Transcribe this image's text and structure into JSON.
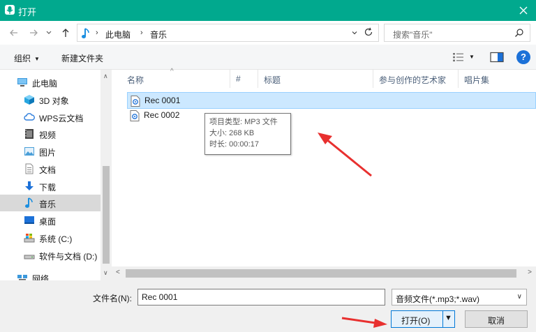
{
  "window": {
    "title": "打开",
    "accent_color": "#01a98e"
  },
  "addressbar": {
    "back_icon": "back-arrow-icon",
    "forward_icon": "forward-arrow-icon",
    "up_icon": "up-arrow-icon",
    "breadcrumbs": [
      "此电脑",
      "音乐"
    ],
    "search_placeholder": "搜索\"音乐\""
  },
  "toolbar": {
    "organize_label": "组织",
    "new_folder_label": "新建文件夹"
  },
  "sidebar": {
    "items": [
      {
        "label": "此电脑",
        "icon": "computer-icon"
      },
      {
        "label": "3D 对象",
        "icon": "cube-3d-icon"
      },
      {
        "label": "WPS云文档",
        "icon": "cloud-icon"
      },
      {
        "label": "视频",
        "icon": "video-icon"
      },
      {
        "label": "图片",
        "icon": "picture-icon"
      },
      {
        "label": "文档",
        "icon": "document-icon"
      },
      {
        "label": "下载",
        "icon": "download-icon"
      },
      {
        "label": "音乐",
        "icon": "music-icon",
        "selected": true
      },
      {
        "label": "桌面",
        "icon": "desktop-icon"
      },
      {
        "label": "系统 (C:)",
        "icon": "drive-c-icon"
      },
      {
        "label": "软件与文档 (D:)",
        "icon": "drive-d-icon"
      },
      {
        "label": "网络",
        "icon": "network-icon"
      }
    ]
  },
  "filelist": {
    "columns": [
      "名称",
      "#",
      "标题",
      "参与创作的艺术家",
      "唱片集"
    ],
    "files": [
      {
        "name": "Rec 0001",
        "selected": true
      },
      {
        "name": "Rec 0002",
        "selected": false
      }
    ],
    "tooltip": {
      "type": "项目类型: MP3 文件",
      "size": "大小: 268 KB",
      "duration": "时长: 00:00:17"
    }
  },
  "footer": {
    "filename_label": "文件名(N):",
    "filename_value": "Rec 0001",
    "filetype_value": "音频文件(*.mp3;*.wav)",
    "open_label": "打开(O)",
    "cancel_label": "取消"
  },
  "annotation_color": "#e8302f"
}
